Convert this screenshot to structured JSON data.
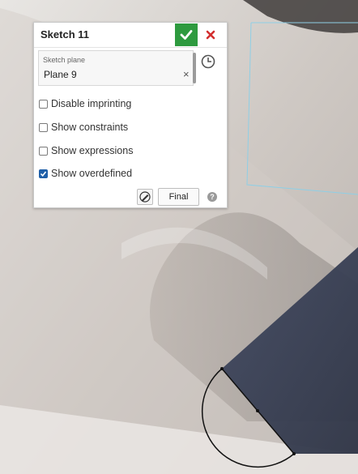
{
  "sketch_panel": {
    "title": "Sketch 11",
    "sketch_plane_label": "Sketch plane",
    "sketch_plane_value": "Plane 9",
    "options": [
      {
        "label": "Disable imprinting",
        "checked": false
      },
      {
        "label": "Show constraints",
        "checked": false
      },
      {
        "label": "Show expressions",
        "checked": false
      },
      {
        "label": "Show overdefined",
        "checked": true
      }
    ],
    "final_label": "Final",
    "help_glyph": "?"
  },
  "icons": {
    "accept": "checkmark-icon",
    "cancel": "close-icon",
    "clear": "clear-x-icon",
    "history": "clock-icon",
    "sketch_tool": "sketch-pencil-icon",
    "help": "help-icon"
  },
  "colors": {
    "accept_green": "#2e9a3f",
    "cancel_red": "#d32f2f",
    "checkbox_blue": "#1f5fa8",
    "solid_face": "#3a4156",
    "plane_outline": "#8ecfe6"
  }
}
